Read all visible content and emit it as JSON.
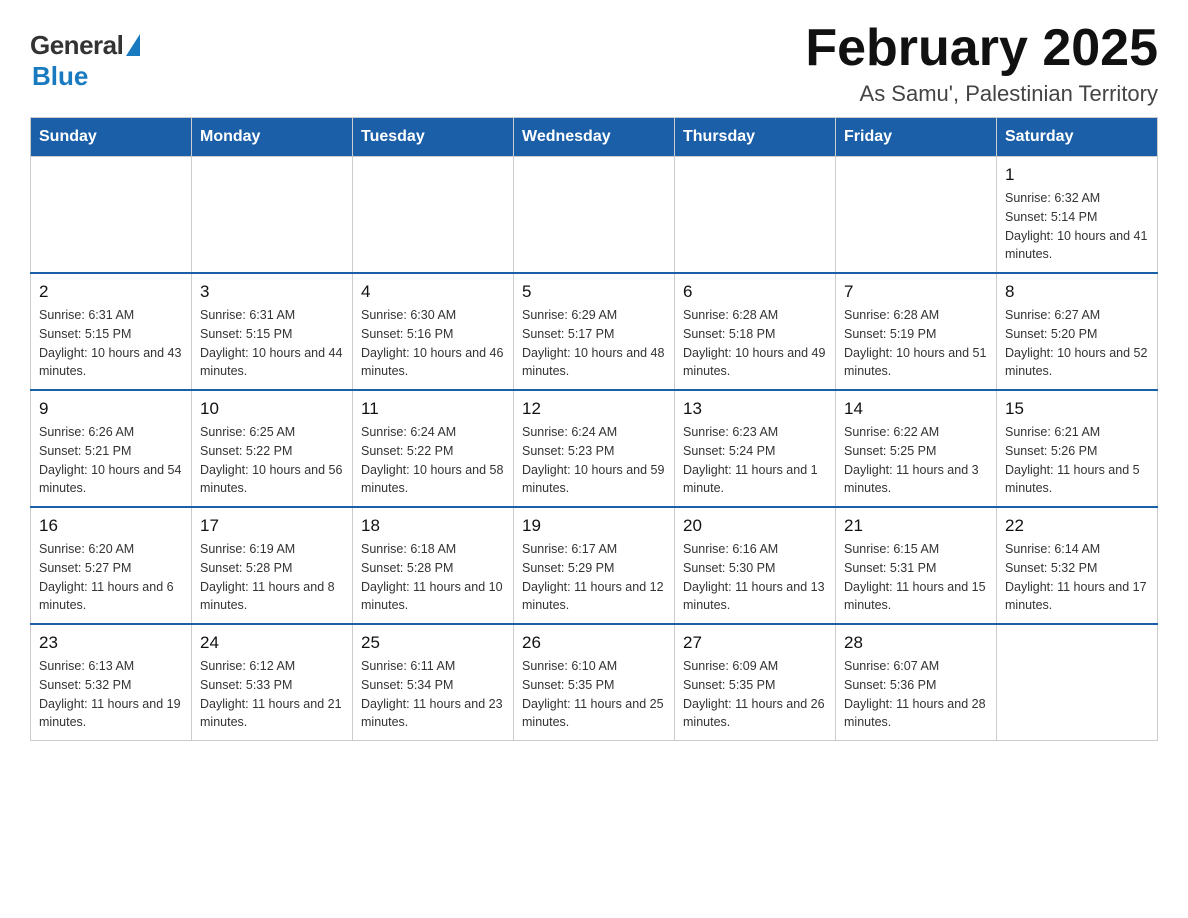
{
  "logo": {
    "general": "General",
    "blue": "Blue"
  },
  "title": "February 2025",
  "subtitle": "As Samu', Palestinian Territory",
  "weekdays": [
    "Sunday",
    "Monday",
    "Tuesday",
    "Wednesday",
    "Thursday",
    "Friday",
    "Saturday"
  ],
  "weeks": [
    [
      {
        "day": "",
        "sunrise": "",
        "sunset": "",
        "daylight": ""
      },
      {
        "day": "",
        "sunrise": "",
        "sunset": "",
        "daylight": ""
      },
      {
        "day": "",
        "sunrise": "",
        "sunset": "",
        "daylight": ""
      },
      {
        "day": "",
        "sunrise": "",
        "sunset": "",
        "daylight": ""
      },
      {
        "day": "",
        "sunrise": "",
        "sunset": "",
        "daylight": ""
      },
      {
        "day": "",
        "sunrise": "",
        "sunset": "",
        "daylight": ""
      },
      {
        "day": "1",
        "sunrise": "Sunrise: 6:32 AM",
        "sunset": "Sunset: 5:14 PM",
        "daylight": "Daylight: 10 hours and 41 minutes."
      }
    ],
    [
      {
        "day": "2",
        "sunrise": "Sunrise: 6:31 AM",
        "sunset": "Sunset: 5:15 PM",
        "daylight": "Daylight: 10 hours and 43 minutes."
      },
      {
        "day": "3",
        "sunrise": "Sunrise: 6:31 AM",
        "sunset": "Sunset: 5:15 PM",
        "daylight": "Daylight: 10 hours and 44 minutes."
      },
      {
        "day": "4",
        "sunrise": "Sunrise: 6:30 AM",
        "sunset": "Sunset: 5:16 PM",
        "daylight": "Daylight: 10 hours and 46 minutes."
      },
      {
        "day": "5",
        "sunrise": "Sunrise: 6:29 AM",
        "sunset": "Sunset: 5:17 PM",
        "daylight": "Daylight: 10 hours and 48 minutes."
      },
      {
        "day": "6",
        "sunrise": "Sunrise: 6:28 AM",
        "sunset": "Sunset: 5:18 PM",
        "daylight": "Daylight: 10 hours and 49 minutes."
      },
      {
        "day": "7",
        "sunrise": "Sunrise: 6:28 AM",
        "sunset": "Sunset: 5:19 PM",
        "daylight": "Daylight: 10 hours and 51 minutes."
      },
      {
        "day": "8",
        "sunrise": "Sunrise: 6:27 AM",
        "sunset": "Sunset: 5:20 PM",
        "daylight": "Daylight: 10 hours and 52 minutes."
      }
    ],
    [
      {
        "day": "9",
        "sunrise": "Sunrise: 6:26 AM",
        "sunset": "Sunset: 5:21 PM",
        "daylight": "Daylight: 10 hours and 54 minutes."
      },
      {
        "day": "10",
        "sunrise": "Sunrise: 6:25 AM",
        "sunset": "Sunset: 5:22 PM",
        "daylight": "Daylight: 10 hours and 56 minutes."
      },
      {
        "day": "11",
        "sunrise": "Sunrise: 6:24 AM",
        "sunset": "Sunset: 5:22 PM",
        "daylight": "Daylight: 10 hours and 58 minutes."
      },
      {
        "day": "12",
        "sunrise": "Sunrise: 6:24 AM",
        "sunset": "Sunset: 5:23 PM",
        "daylight": "Daylight: 10 hours and 59 minutes."
      },
      {
        "day": "13",
        "sunrise": "Sunrise: 6:23 AM",
        "sunset": "Sunset: 5:24 PM",
        "daylight": "Daylight: 11 hours and 1 minute."
      },
      {
        "day": "14",
        "sunrise": "Sunrise: 6:22 AM",
        "sunset": "Sunset: 5:25 PM",
        "daylight": "Daylight: 11 hours and 3 minutes."
      },
      {
        "day": "15",
        "sunrise": "Sunrise: 6:21 AM",
        "sunset": "Sunset: 5:26 PM",
        "daylight": "Daylight: 11 hours and 5 minutes."
      }
    ],
    [
      {
        "day": "16",
        "sunrise": "Sunrise: 6:20 AM",
        "sunset": "Sunset: 5:27 PM",
        "daylight": "Daylight: 11 hours and 6 minutes."
      },
      {
        "day": "17",
        "sunrise": "Sunrise: 6:19 AM",
        "sunset": "Sunset: 5:28 PM",
        "daylight": "Daylight: 11 hours and 8 minutes."
      },
      {
        "day": "18",
        "sunrise": "Sunrise: 6:18 AM",
        "sunset": "Sunset: 5:28 PM",
        "daylight": "Daylight: 11 hours and 10 minutes."
      },
      {
        "day": "19",
        "sunrise": "Sunrise: 6:17 AM",
        "sunset": "Sunset: 5:29 PM",
        "daylight": "Daylight: 11 hours and 12 minutes."
      },
      {
        "day": "20",
        "sunrise": "Sunrise: 6:16 AM",
        "sunset": "Sunset: 5:30 PM",
        "daylight": "Daylight: 11 hours and 13 minutes."
      },
      {
        "day": "21",
        "sunrise": "Sunrise: 6:15 AM",
        "sunset": "Sunset: 5:31 PM",
        "daylight": "Daylight: 11 hours and 15 minutes."
      },
      {
        "day": "22",
        "sunrise": "Sunrise: 6:14 AM",
        "sunset": "Sunset: 5:32 PM",
        "daylight": "Daylight: 11 hours and 17 minutes."
      }
    ],
    [
      {
        "day": "23",
        "sunrise": "Sunrise: 6:13 AM",
        "sunset": "Sunset: 5:32 PM",
        "daylight": "Daylight: 11 hours and 19 minutes."
      },
      {
        "day": "24",
        "sunrise": "Sunrise: 6:12 AM",
        "sunset": "Sunset: 5:33 PM",
        "daylight": "Daylight: 11 hours and 21 minutes."
      },
      {
        "day": "25",
        "sunrise": "Sunrise: 6:11 AM",
        "sunset": "Sunset: 5:34 PM",
        "daylight": "Daylight: 11 hours and 23 minutes."
      },
      {
        "day": "26",
        "sunrise": "Sunrise: 6:10 AM",
        "sunset": "Sunset: 5:35 PM",
        "daylight": "Daylight: 11 hours and 25 minutes."
      },
      {
        "day": "27",
        "sunrise": "Sunrise: 6:09 AM",
        "sunset": "Sunset: 5:35 PM",
        "daylight": "Daylight: 11 hours and 26 minutes."
      },
      {
        "day": "28",
        "sunrise": "Sunrise: 6:07 AM",
        "sunset": "Sunset: 5:36 PM",
        "daylight": "Daylight: 11 hours and 28 minutes."
      },
      {
        "day": "",
        "sunrise": "",
        "sunset": "",
        "daylight": ""
      }
    ]
  ]
}
